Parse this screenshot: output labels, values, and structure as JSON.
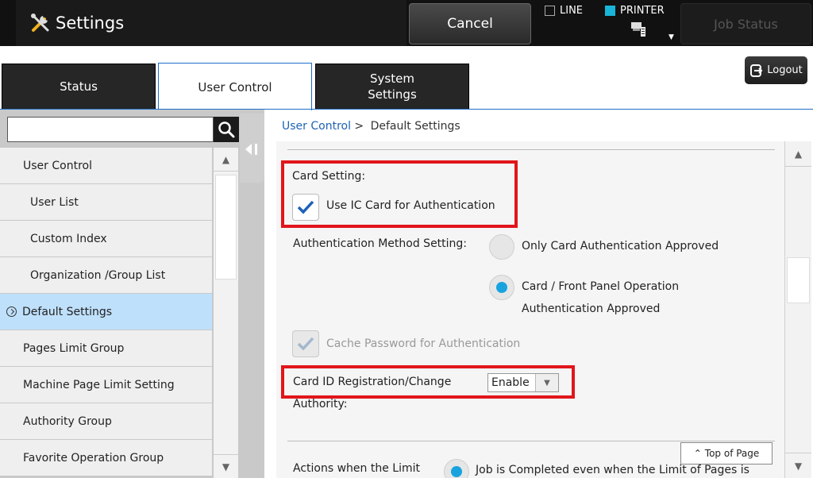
{
  "header": {
    "title": "Settings",
    "cancel_label": "Cancel",
    "line_label": "LINE",
    "printer_label": "PRINTER",
    "job_status_label": "Job Status",
    "printer_indicator_color": "#19b5d8"
  },
  "tabs": [
    {
      "label": "Status"
    },
    {
      "label": "User Control"
    },
    {
      "label": "System Settings"
    }
  ],
  "logout_label": "Logout",
  "search": {
    "value": ""
  },
  "sidebar": {
    "items": [
      {
        "label": "User Control"
      },
      {
        "label": "User List"
      },
      {
        "label": "Custom Index"
      },
      {
        "label": "Organization /Group List"
      },
      {
        "label": "Default Settings"
      },
      {
        "label": "Pages Limit Group"
      },
      {
        "label": "Machine Page Limit Setting"
      },
      {
        "label": "Authority Group"
      },
      {
        "label": "Favorite Operation Group"
      }
    ]
  },
  "breadcrumb": {
    "link": "User Control",
    "separator": ">",
    "current": "Default Settings"
  },
  "content": {
    "card_setting_label": "Card Setting:",
    "use_ic_card_label": "Use IC Card for Authentication",
    "auth_method_label": "Authentication Method Setting:",
    "option_only_card": "Only Card Authentication Approved",
    "option_card_front_line1": "Card / Front Panel Operation",
    "option_card_front_line2": "Authentication Approved",
    "cache_password_label": "Cache Password for Authentication",
    "card_id_reg_line1": "Card ID Registration/Change",
    "card_id_reg_line2": "Authority:",
    "card_id_reg_value": "Enable",
    "top_of_page_label": "Top of Page",
    "actions_limit_label": "Actions when the Limit",
    "job_completed_label": "Job is Completed even when the Limit of Pages is"
  },
  "highlight_color": "#e0161b"
}
